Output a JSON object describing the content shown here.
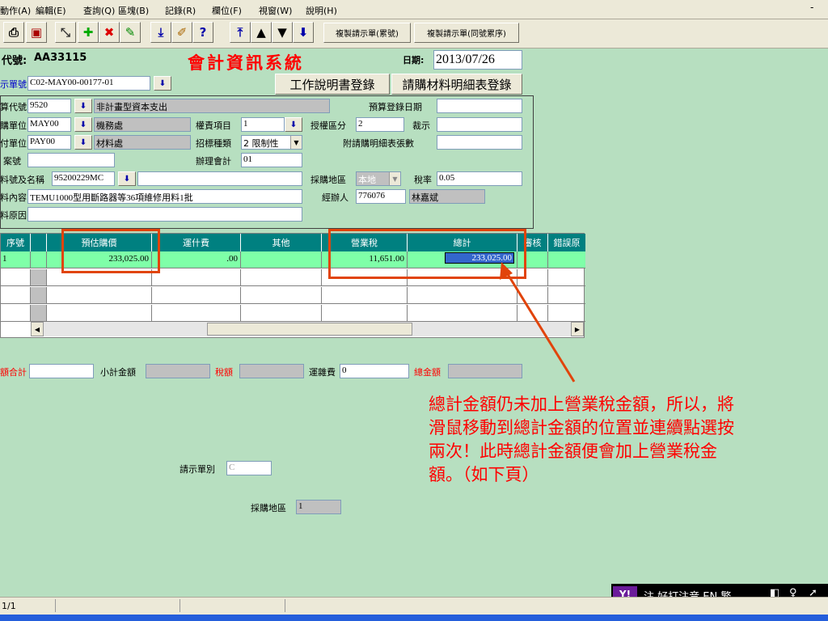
{
  "menu": [
    "動作(A)",
    "編輯(E)",
    "查詢(Q)",
    "區塊(B)",
    "記錄(R)",
    "欄位(F)",
    "視窗(W)",
    "說明(H)"
  ],
  "window_min": "-",
  "toolbar": {
    "icons": [
      "printer-icon",
      "doc-icon",
      "tool-icon",
      "plus-icon",
      "x-icon",
      "edit-icon",
      "down-arrow-icon",
      "pen-icon",
      "help-icon",
      "up-icon",
      "prev-icon",
      "next-icon",
      "last-icon"
    ],
    "copy_seq_label": "複製請示單(累號)",
    "copy_same_label": "複製請示單(同號累序)"
  },
  "header": {
    "code_label": "代號:",
    "code_value": "AA33115",
    "title": "會計資訊系統",
    "date_label": "日期:",
    "date_value": "2013/07/26"
  },
  "form": {
    "order_label": "示單號",
    "order_value": "C02-MAY00-00177-01",
    "work_btn": "工作說明書登錄",
    "material_btn": "請購材料明細表登錄",
    "budget_code_label": "算代號",
    "budget_code_value": "9520",
    "budget_code_desc": "非計畫型資本支出",
    "budget_date_label": "預算登錄日期",
    "budget_date_value": "",
    "req_unit_label": "購單位",
    "req_unit_value": "MAY00",
    "req_unit_desc": "機務處",
    "rights_label": "權責項目",
    "rights_value": "1",
    "auth_label": "授權區分",
    "auth_value": "2",
    "approve_label": "裁示",
    "approve_value": "",
    "pay_unit_label": "付單位",
    "pay_unit_value": "PAY00",
    "pay_unit_desc": "材料處",
    "bid_label": "招標種類",
    "bid_value": "2 限制性",
    "attach_label": "附請購明細表張數",
    "attach_value": "",
    "case_label": "案號",
    "case_value": "",
    "acct_label": "辦理會計",
    "acct_value": "01",
    "item_label": "料號及名稱",
    "item_value": "95200229MC",
    "item_desc": "",
    "region_label": "採購地區",
    "region_value": "本地",
    "tax_label": "稅率",
    "tax_value": "0.05",
    "content_label": "料內容",
    "content_value": "TEMU1000型用斷路器等36項維修用料1批",
    "handler_label": "經辦人",
    "handler_id": "776076",
    "handler_name": "林嘉斌",
    "reason_label": "料原因",
    "reason_value": ""
  },
  "grid": {
    "headers": [
      "序號",
      "預估購價",
      "運什費",
      "其他",
      "營業稅",
      "總計",
      "審核",
      "錯誤原"
    ],
    "row1": {
      "seq": "1",
      "est_price": "233,025.00",
      "freight": ".00",
      "other": "",
      "tax": "11,651.00",
      "total": "233,025.00"
    }
  },
  "totals": {
    "sum_label": "額合計",
    "sum_value": "",
    "subtotal_label": "小計金額",
    "subtotal_value": "",
    "tax_label": "稅額",
    "tax_value": "",
    "freight_label": "運雜費",
    "freight_value": "0",
    "grand_label": "總金額",
    "grand_value": ""
  },
  "extra": {
    "type_label": "請示單別",
    "type_value": "C",
    "region_label": "採購地區",
    "region_value": "1"
  },
  "annotation": "總計金額仍未加上營業稅金額，所以，將滑鼠移動到總計金額的位置並連續點選按兩次！此時總計金額便會加上營業稅金額。（如下頁）",
  "status": {
    "record": "1/1"
  },
  "ime": {
    "text": "注 好打注音  EN 繁"
  }
}
